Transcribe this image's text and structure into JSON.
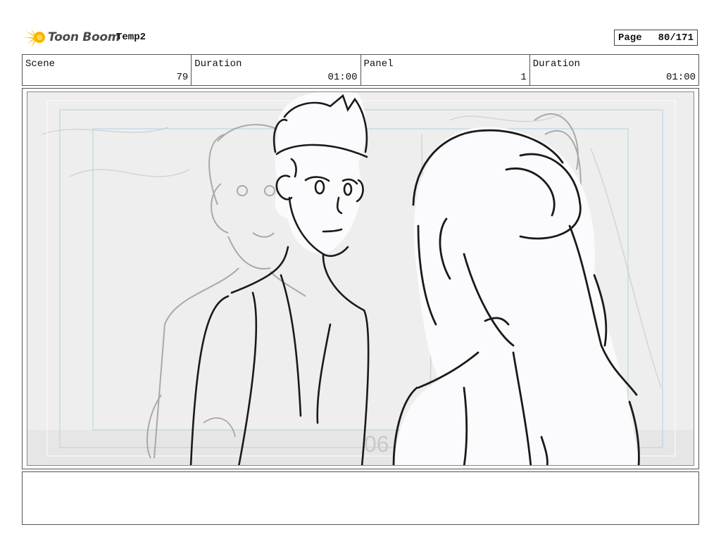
{
  "header": {
    "logo_text": "Toon Boom",
    "project_name": "Temp2",
    "page_label": "Page",
    "page_value": "80/171"
  },
  "info": [
    {
      "label": "Scene",
      "value": "79"
    },
    {
      "label": "Duration",
      "value": "01:00"
    },
    {
      "label": "Panel",
      "value": "1"
    },
    {
      "label": "Duration",
      "value": "01:00"
    }
  ],
  "panel": {
    "frame_number": "06"
  },
  "notes": {
    "text": ""
  }
}
